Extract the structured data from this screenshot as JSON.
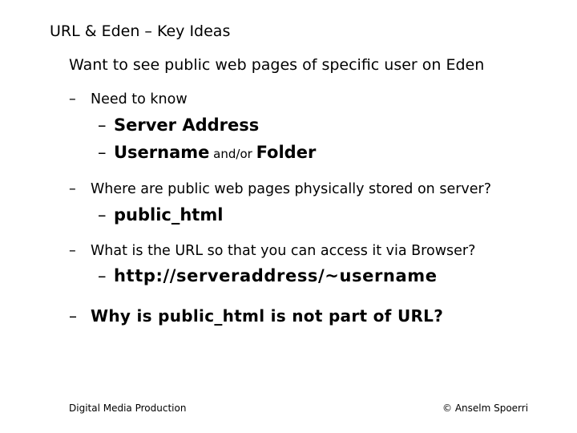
{
  "slide": {
    "title": "URL & Eden – Key Ideas",
    "intro": "Want to see public web pages of specific user on Eden",
    "dash": "–",
    "items": [
      {
        "text": "Need to know",
        "sub": [
          {
            "parts": [
              "Server Address"
            ]
          },
          {
            "parts": [
              "Username",
              " and/or ",
              "Folder"
            ]
          }
        ]
      },
      {
        "text": "Where are public web pages physically stored on server?",
        "sub": [
          {
            "parts": [
              "public_html"
            ]
          }
        ]
      },
      {
        "text": "What is the URL so that you can access it via Browser?",
        "sub": [
          {
            "parts": [
              "http://serveraddress/~username"
            ]
          }
        ]
      },
      {
        "text": "Why is public_html is not part of URL?"
      }
    ],
    "footer": {
      "left": "Digital Media Production",
      "right": "© Anselm Spoerri"
    }
  }
}
